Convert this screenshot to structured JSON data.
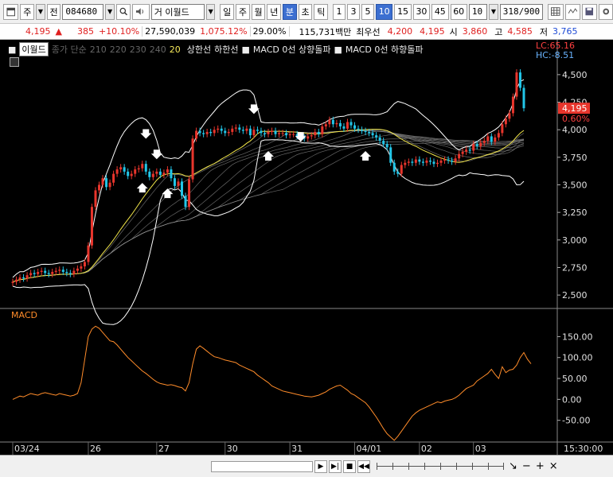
{
  "toolbar": {
    "b0": "주",
    "b1": "전",
    "code": "084680",
    "name": "거 이월드",
    "period_buttons": [
      "일",
      "주",
      "월",
      "년",
      "분",
      "초",
      "틱"
    ],
    "interval_buttons": [
      "1",
      "3",
      "5",
      "10",
      "15",
      "30",
      "45",
      "60"
    ],
    "active_period": "분",
    "active_interval": "10",
    "count_value": "10",
    "range_text": "318/900"
  },
  "quote": {
    "price": "4,195",
    "change": "385",
    "change_pct": "+10.10%",
    "volume": "27,590,039",
    "volume_pct": "1,075.12%",
    "turnover": "29.00%",
    "amount": "115,731백만",
    "best_label": "최우선",
    "best_ask": "4,200",
    "best_bid": "4,195",
    "open_label": "시",
    "open": "3,860",
    "high_label": "고",
    "high": "4,585",
    "low_label": "저",
    "low": "3,765"
  },
  "chart": {
    "stock_name": "이월드",
    "ma_list": [
      "종가 단순",
      "210",
      "220",
      "230",
      "240"
    ],
    "ma20": "20",
    "band_upper": "상한선",
    "band_lower": "하한선",
    "macd_up": "MACD 0선 상향돌파",
    "macd_down": "MACD 0선 하향돌파",
    "lc": "LC:65.16",
    "hc": "HC:-8.51",
    "current_price": "4,195",
    "current_pct": "0.60%",
    "macd_label": "MACD",
    "colors": {
      "up": "#e8352c",
      "down": "#22c6e8",
      "ma20": "#f2e64a",
      "macd": "#ff8c2a",
      "band": "#ffffff"
    }
  },
  "chart_data": {
    "type": "line",
    "title": "",
    "price_axis_ticks": [
      "4,500",
      "4,250",
      "4,000",
      "3,750",
      "3,500",
      "3,250",
      "3,000",
      "2,750",
      "2,500"
    ],
    "macd_axis_ticks": [
      "150.00",
      "100.00",
      "50.00",
      "0.00",
      "-50.00"
    ],
    "x_tick_labels": [
      "03/24",
      "26",
      "27",
      "30",
      "31",
      "04/01",
      "02",
      "03",
      "15:30:00"
    ],
    "ylim": [
      2400,
      4600
    ],
    "macd_ylim": [
      -100,
      185
    ],
    "close": [
      2620,
      2640,
      2660,
      2650,
      2680,
      2700,
      2690,
      2710,
      2720,
      2700,
      2690,
      2710,
      2720,
      2730,
      2710,
      2700,
      2690,
      2720,
      2740,
      2760,
      2800,
      2950,
      3300,
      3450,
      3500,
      3560,
      3480,
      3520,
      3600,
      3640,
      3660,
      3620,
      3580,
      3600,
      3640,
      3650,
      3690,
      3620,
      3570,
      3600,
      3620,
      3590,
      3610,
      3640,
      3560,
      3490,
      3530,
      3400,
      3300,
      3550,
      3920,
      3990,
      3970,
      3960,
      3980,
      3970,
      4000,
      4010,
      3990,
      3970,
      3980,
      4010,
      4020,
      4000,
      3990,
      4010,
      3950,
      4000,
      3990,
      3970,
      3960,
      3980,
      3990,
      3960,
      3970,
      3970,
      3950,
      3960,
      3960,
      3940,
      3930,
      3920,
      3940,
      3950,
      3980,
      3960,
      4030,
      4050,
      4090,
      4050,
      4060,
      4030,
      4010,
      4070,
      4040,
      4010,
      4000,
      3990,
      3980,
      3970,
      3950,
      3930,
      3900,
      3870,
      3840,
      3700,
      3620,
      3600,
      3680,
      3700,
      3710,
      3700,
      3730,
      3710,
      3700,
      3720,
      3710,
      3690,
      3700,
      3720,
      3730,
      3720,
      3710,
      3740,
      3780,
      3800,
      3820,
      3810,
      3870,
      3850,
      3880,
      3900,
      3940,
      3890,
      3930,
      3970,
      4050,
      4100,
      4150,
      4300,
      4520,
      4380,
      4195
    ],
    "macd": [
      0,
      4,
      8,
      6,
      10,
      14,
      12,
      10,
      14,
      16,
      14,
      12,
      10,
      14,
      12,
      10,
      8,
      10,
      14,
      40,
      95,
      150,
      168,
      175,
      170,
      160,
      150,
      140,
      138,
      130,
      120,
      110,
      100,
      92,
      84,
      76,
      68,
      62,
      55,
      48,
      42,
      38,
      36,
      34,
      35,
      33,
      30,
      28,
      20,
      40,
      85,
      120,
      128,
      122,
      115,
      108,
      102,
      100,
      97,
      94,
      92,
      90,
      88,
      82,
      78,
      74,
      70,
      66,
      58,
      52,
      46,
      40,
      32,
      28,
      24,
      20,
      18,
      16,
      14,
      12,
      10,
      8,
      7,
      6,
      8,
      10,
      14,
      18,
      24,
      28,
      32,
      34,
      28,
      22,
      14,
      10,
      4,
      -2,
      -8,
      -18,
      -30,
      -42,
      -56,
      -70,
      -82,
      -90,
      -98,
      -88,
      -76,
      -64,
      -52,
      -40,
      -32,
      -26,
      -22,
      -18,
      -14,
      -10,
      -6,
      -8,
      -4,
      -2,
      0,
      4,
      10,
      18,
      26,
      30,
      34,
      44,
      50,
      56,
      62,
      72,
      60,
      50,
      78,
      64,
      70,
      72,
      82,
      100,
      112,
      96,
      85
    ],
    "series": [
      {
        "name": "이월드",
        "values": "close"
      },
      {
        "name": "MACD",
        "values": "macd"
      }
    ]
  },
  "bottom": {
    "time": "15:30:00"
  }
}
